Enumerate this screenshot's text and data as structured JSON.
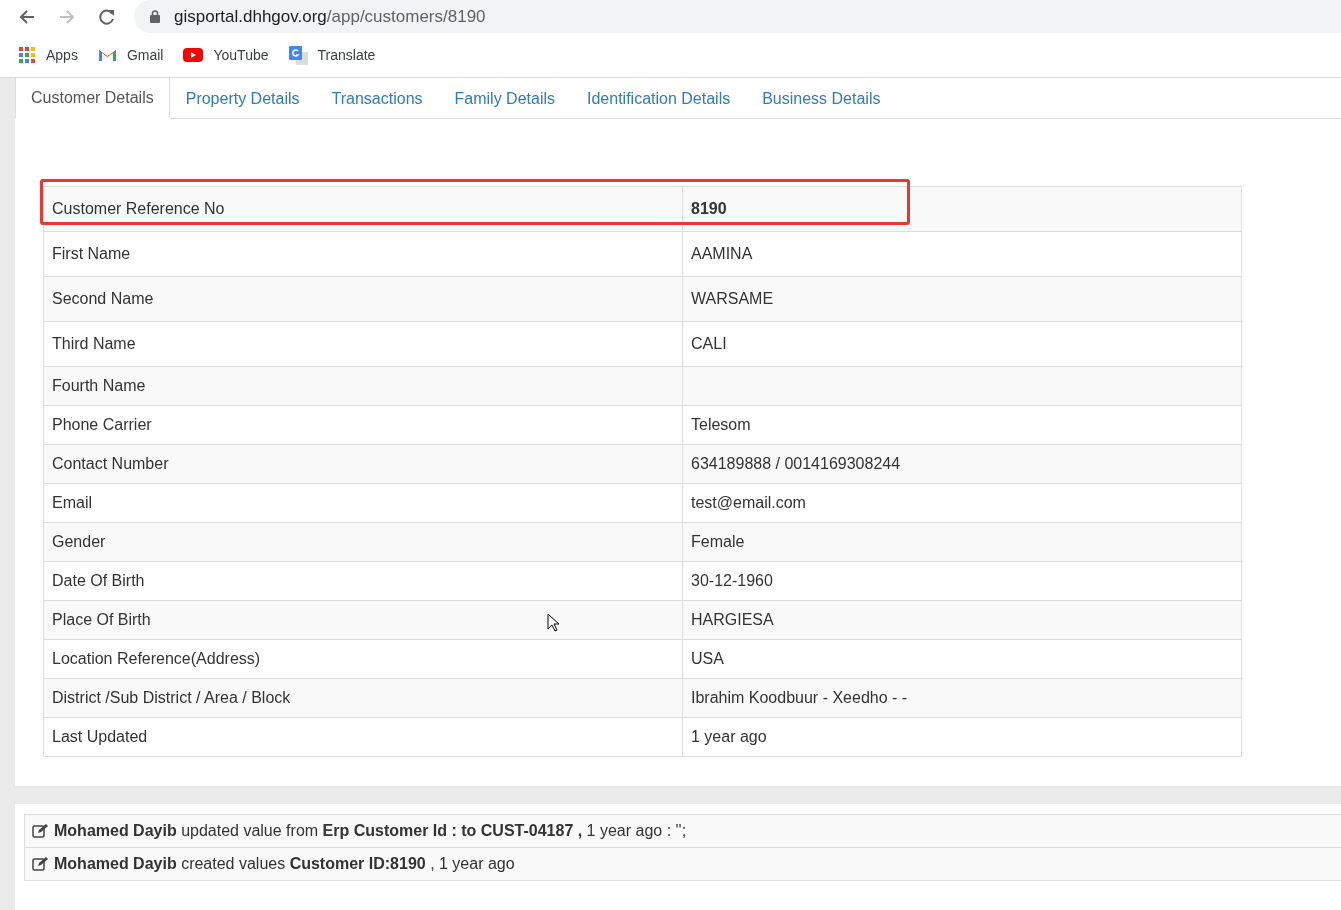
{
  "browser": {
    "url_host": "gisportal.dhhgov.org",
    "url_path": "/app/customers/8190",
    "bookmarks": [
      {
        "kind": "apps",
        "label": "Apps"
      },
      {
        "kind": "gmail",
        "label": "Gmail"
      },
      {
        "kind": "youtube",
        "label": "YouTube"
      },
      {
        "kind": "translate",
        "label": "Translate"
      }
    ]
  },
  "tabs": [
    {
      "label": "Customer Details",
      "selected": true
    },
    {
      "label": "Property Details",
      "selected": false
    },
    {
      "label": "Transactions",
      "selected": false
    },
    {
      "label": "Family Details",
      "selected": false
    },
    {
      "label": "Identification Details",
      "selected": false
    },
    {
      "label": "Business Details",
      "selected": false
    }
  ],
  "details": [
    {
      "label": "Customer Reference No",
      "value": "8190",
      "highlighted": true
    },
    {
      "label": "First Name",
      "value": "AAMINA",
      "highlighted": false
    },
    {
      "label": "Second Name",
      "value": "WARSAME",
      "highlighted": false
    },
    {
      "label": "Third Name",
      "value": "CALI",
      "highlighted": false
    },
    {
      "label": "Fourth Name",
      "highlighted": false
    },
    {
      "label": "Phone Carrier",
      "value": "Telesom",
      "highlighted": false
    },
    {
      "label": "Contact Number",
      "value": "634189888 / 0014169308244",
      "highlighted": false
    },
    {
      "label": "Email",
      "value": "test@email.com",
      "highlighted": false
    },
    {
      "label": "Gender",
      "value": "Female",
      "highlighted": false
    },
    {
      "label": "Date Of Birth",
      "value": "30-12-1960",
      "highlighted": false
    },
    {
      "label": "Place Of Birth",
      "value": "HARGIESA",
      "highlighted": false
    },
    {
      "label": "Location Reference(Address)",
      "value": "USA",
      "highlighted": false
    },
    {
      "label": "District /Sub District / Area / Block",
      "value": "Ibrahim Koodbuur - Xeedho - -",
      "highlighted": false
    },
    {
      "label": "Last Updated",
      "value": "1 year ago",
      "highlighted": false
    }
  ],
  "activity_log": [
    "**Mohamed Dayib** updated value from **Erp Customer Id : to CUST-04187 ,** 1 year ago : '';",
    "**Mohamed Dayib** created values **Customer ID:8190** , 1 year ago"
  ]
}
